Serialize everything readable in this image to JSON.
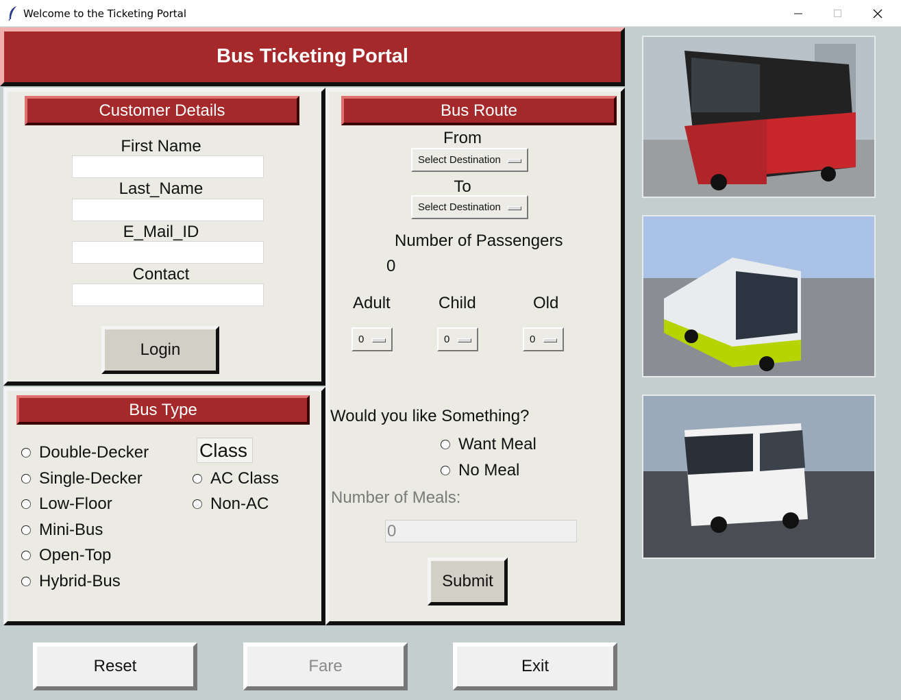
{
  "window": {
    "title": "Welcome to the Ticketing Portal"
  },
  "header": {
    "title": "Bus Ticketing Portal"
  },
  "customer": {
    "heading": "Customer Details",
    "first_name_label": "First  Name",
    "last_name_label": "Last_Name",
    "email_label": "E_Mail_ID",
    "contact_label": "Contact",
    "first_name_value": "",
    "last_name_value": "",
    "email_value": "",
    "contact_value": "",
    "login_label": "Login"
  },
  "route": {
    "heading": "Bus Route",
    "from_label": "From",
    "from_value": "Select Destination",
    "to_label": "To",
    "to_value": "Select Destination",
    "passengers_label": "Number of Passengers",
    "passengers_value": "0",
    "adult_label": "Adult",
    "child_label": "Child",
    "old_label": "Old",
    "adult_value": "0",
    "child_value": "0",
    "old_value": "0"
  },
  "bustype": {
    "heading": "Bus Type",
    "options": [
      "Double-Decker",
      "Single-Decker",
      "Low-Floor",
      "Mini-Bus",
      "Open-Top",
      "Hybrid-Bus"
    ],
    "class_label": "Class",
    "class_options": [
      "AC Class",
      "Non-AC"
    ]
  },
  "meal": {
    "question": "Would you like Something?",
    "options": [
      "Want Meal",
      "No Meal"
    ],
    "count_label": "Number of Meals:",
    "count_value": "0",
    "submit_label": "Submit"
  },
  "footer": {
    "reset_label": "Reset",
    "fare_label": "Fare",
    "exit_label": "Exit"
  },
  "colors": {
    "accent_red": "#a5282b",
    "panel": "#ebebe3",
    "background": "#c3cece"
  }
}
